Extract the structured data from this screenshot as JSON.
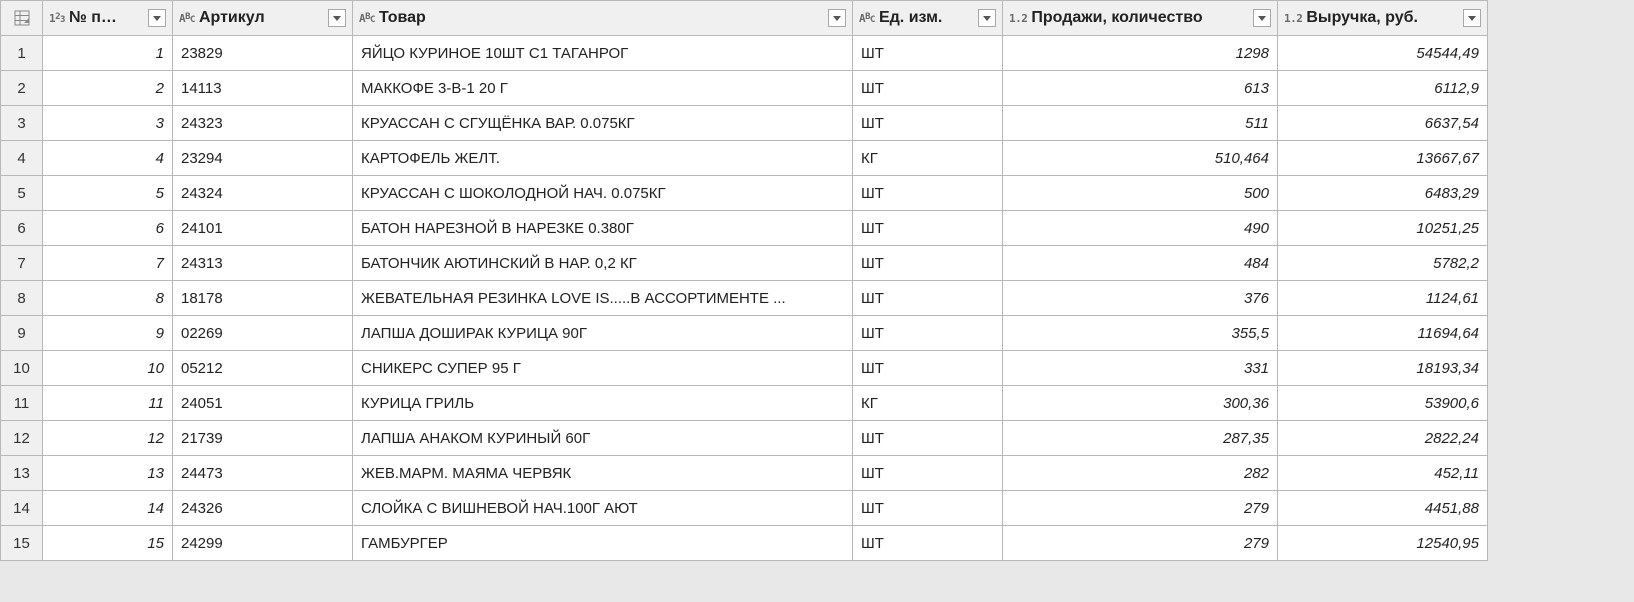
{
  "columns": {
    "num": {
      "label": "№ п…"
    },
    "art": {
      "label": "Артикул"
    },
    "product": {
      "label": "Товар"
    },
    "unit": {
      "label": "Ед. изм."
    },
    "qty": {
      "label": "Продажи, количество"
    },
    "rev": {
      "label": "Выручка, руб."
    }
  },
  "rows": [
    {
      "n": "1",
      "num": "1",
      "art": "23829",
      "product": "ЯЙЦО КУРИНОЕ 10ШТ С1 ТАГАНРОГ",
      "unit": "ШТ",
      "qty": "1298",
      "rev": "54544,49"
    },
    {
      "n": "2",
      "num": "2",
      "art": "14113",
      "product": "МАККОФЕ 3-В-1 20 Г",
      "unit": "ШТ",
      "qty": "613",
      "rev": "6112,9"
    },
    {
      "n": "3",
      "num": "3",
      "art": "24323",
      "product": "КРУАССАН С СГУЩЁНКА ВАР.  0.075КГ",
      "unit": "ШТ",
      "qty": "511",
      "rev": "6637,54"
    },
    {
      "n": "4",
      "num": "4",
      "art": "23294",
      "product": "КАРТОФЕЛЬ ЖЕЛТ.",
      "unit": "КГ",
      "qty": "510,464",
      "rev": "13667,67"
    },
    {
      "n": "5",
      "num": "5",
      "art": "24324",
      "product": "КРУАССАН С ШОКОЛОДНОЙ НАЧ.  0.075КГ",
      "unit": "ШТ",
      "qty": "500",
      "rev": "6483,29"
    },
    {
      "n": "6",
      "num": "6",
      "art": "24101",
      "product": "БАТОН НАРЕЗНОЙ В НАРЕЗКЕ 0.380Г",
      "unit": "ШТ",
      "qty": "490",
      "rev": "10251,25"
    },
    {
      "n": "7",
      "num": "7",
      "art": "24313",
      "product": "БАТОНЧИК АЮТИНСКИЙ В НАР. 0,2 КГ",
      "unit": "ШТ",
      "qty": "484",
      "rev": "5782,2"
    },
    {
      "n": "8",
      "num": "8",
      "art": "18178",
      "product": "ЖЕВАТЕЛЬНАЯ РЕЗИНКА  LOVE IS.....В АССОРТИМЕНТЕ ...",
      "unit": "ШТ",
      "qty": "376",
      "rev": "1124,61"
    },
    {
      "n": "9",
      "num": "9",
      "art": "02269",
      "product": "ЛАПША ДОШИРАК КУРИЦА 90Г",
      "unit": "ШТ",
      "qty": "355,5",
      "rev": "11694,64"
    },
    {
      "n": "10",
      "num": "10",
      "art": "05212",
      "product": "СНИКЕРС СУПЕР 95 Г",
      "unit": "ШТ",
      "qty": "331",
      "rev": "18193,34"
    },
    {
      "n": "11",
      "num": "11",
      "art": "24051",
      "product": "КУРИЦА ГРИЛЬ",
      "unit": "КГ",
      "qty": "300,36",
      "rev": "53900,6"
    },
    {
      "n": "12",
      "num": "12",
      "art": "21739",
      "product": "ЛАПША АНАКОМ КУРИНЫЙ  60Г",
      "unit": "ШТ",
      "qty": "287,35",
      "rev": "2822,24"
    },
    {
      "n": "13",
      "num": "13",
      "art": "24473",
      "product": "ЖЕВ.МАРМ. МАЯМА ЧЕРВЯК",
      "unit": "ШТ",
      "qty": "282",
      "rev": "452,11"
    },
    {
      "n": "14",
      "num": "14",
      "art": "24326",
      "product": "СЛОЙКА С ВИШНЕВОЙ НАЧ.100Г АЮТ",
      "unit": "ШТ",
      "qty": "279",
      "rev": "4451,88"
    },
    {
      "n": "15",
      "num": "15",
      "art": "24299",
      "product": "ГАМБУРГЕР",
      "unit": "ШТ",
      "qty": "279",
      "rev": "12540,95"
    }
  ]
}
